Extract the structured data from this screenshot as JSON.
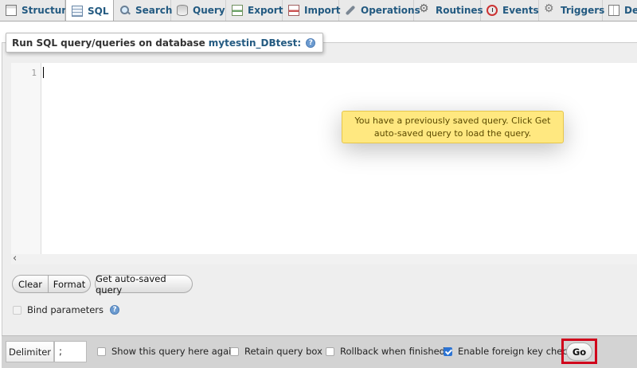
{
  "tabs": [
    {
      "label": "Structure",
      "icon": "structure-icon",
      "active": false
    },
    {
      "label": "SQL",
      "icon": "sql-icon",
      "active": true
    },
    {
      "label": "Search",
      "icon": "search-icon",
      "active": false
    },
    {
      "label": "Query",
      "icon": "query-icon",
      "active": false
    },
    {
      "label": "Export",
      "icon": "export-icon",
      "active": false
    },
    {
      "label": "Import",
      "icon": "import-icon",
      "active": false
    },
    {
      "label": "Operations",
      "icon": "operations-icon",
      "active": false
    },
    {
      "label": "Routines",
      "icon": "routines-icon",
      "active": false
    },
    {
      "label": "Events",
      "icon": "events-icon",
      "active": false
    },
    {
      "label": "Triggers",
      "icon": "triggers-icon",
      "active": false
    },
    {
      "label": "De",
      "icon": "designer-icon",
      "active": false
    }
  ],
  "panel": {
    "legend_prefix": "Run SQL query/queries on database",
    "database": "mytestin_DBtest:",
    "help": "?"
  },
  "editor": {
    "line_number": "1",
    "content": "",
    "scroll_left": "‹"
  },
  "toast": {
    "message": "You have a previously saved query. Click Get auto-saved query to load the query."
  },
  "buttons": {
    "clear": "Clear",
    "format": "Format",
    "get_autosaved": "Get auto-saved query",
    "go": "Go"
  },
  "bind_parameters": {
    "label": "Bind parameters",
    "checked": false
  },
  "footer": {
    "delimiter_label": "Delimiter",
    "delimiter_value": ";",
    "options": [
      {
        "label": "Show this query here again",
        "checked": false
      },
      {
        "label": "Retain query box",
        "checked": false
      },
      {
        "label": "Rollback when finished",
        "checked": false
      },
      {
        "label": "Enable foreign key checks",
        "checked": true
      }
    ]
  },
  "colors": {
    "tab_text": "#235a81",
    "toast_bg": "#ffe880",
    "highlight_outline": "#d0021b",
    "checkbox_checked": "#2b73d3"
  }
}
